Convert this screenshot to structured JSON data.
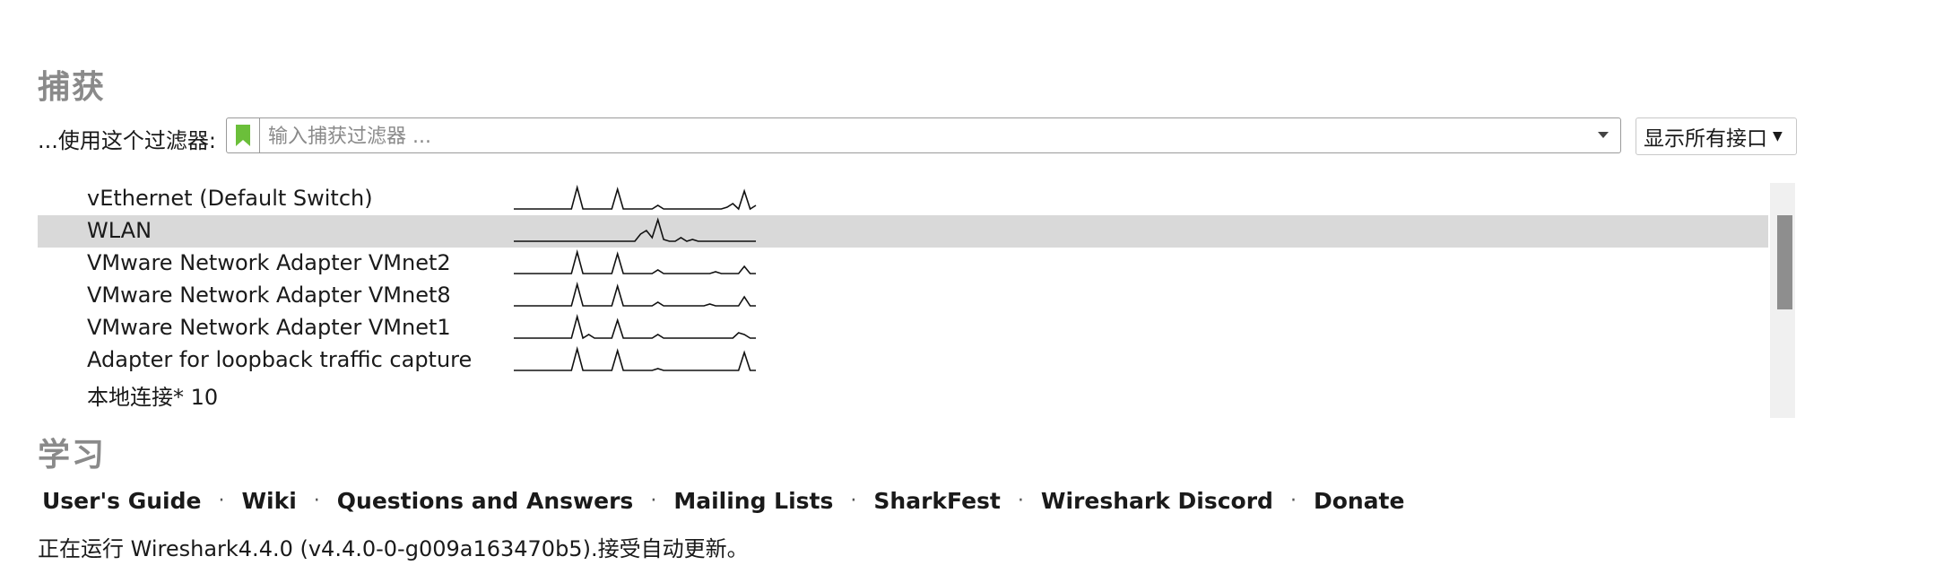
{
  "capture": {
    "heading": "捕获",
    "filter_label": "...使用这个过滤器:",
    "filter_placeholder": "输入捕获过滤器 ...",
    "filter_value": "",
    "interfaces_button": "显示所有接口",
    "bookmark_color": "#6bbf3a"
  },
  "interfaces": [
    {
      "name": "vEthernet (Default Switch)",
      "selected": false,
      "sparkline": [
        0,
        0,
        0,
        0,
        0,
        0,
        0,
        0,
        0,
        0,
        0,
        12,
        0,
        0,
        0,
        0,
        0,
        0,
        11,
        0,
        0,
        0,
        0,
        0,
        0,
        2,
        0,
        0,
        0,
        0,
        0,
        0,
        0,
        0,
        0,
        0,
        0,
        1,
        3,
        0,
        10,
        0,
        2
      ]
    },
    {
      "name": "WLAN",
      "selected": true,
      "sparkline": [
        0,
        0,
        0,
        0,
        0,
        0,
        0,
        0,
        0,
        0,
        0,
        0,
        0,
        0,
        0,
        0,
        0,
        0,
        0,
        0,
        0,
        0,
        4,
        6,
        2,
        12,
        1,
        0,
        0,
        2,
        0,
        1,
        0,
        0,
        0,
        0,
        0,
        0,
        0,
        0,
        0,
        0,
        0
      ]
    },
    {
      "name": "VMware Network Adapter VMnet2",
      "selected": false,
      "sparkline": [
        0,
        0,
        0,
        0,
        0,
        0,
        0,
        0,
        0,
        0,
        0,
        12,
        0,
        0,
        0,
        0,
        0,
        0,
        11,
        0,
        0,
        0,
        0,
        0,
        0,
        2,
        0,
        0,
        0,
        0,
        0,
        0,
        0,
        0,
        0,
        1,
        0,
        0,
        0,
        0,
        4,
        0,
        0
      ]
    },
    {
      "name": "VMware Network Adapter VMnet8",
      "selected": false,
      "sparkline": [
        0,
        0,
        0,
        0,
        0,
        0,
        0,
        0,
        0,
        0,
        0,
        12,
        0,
        0,
        0,
        0,
        0,
        0,
        11,
        0,
        0,
        0,
        0,
        0,
        0,
        2,
        0,
        0,
        0,
        0,
        0,
        0,
        0,
        0,
        1,
        0,
        0,
        0,
        0,
        0,
        5,
        0,
        0
      ]
    },
    {
      "name": "VMware Network Adapter VMnet1",
      "selected": false,
      "sparkline": [
        0,
        0,
        0,
        0,
        0,
        0,
        0,
        0,
        0,
        0,
        0,
        12,
        0,
        2,
        0,
        0,
        0,
        0,
        10,
        0,
        0,
        0,
        0,
        0,
        0,
        2,
        0,
        0,
        0,
        0,
        0,
        0,
        0,
        0,
        0,
        0,
        0,
        0,
        0,
        3,
        2,
        0,
        0
      ]
    },
    {
      "name": "Adapter for loopback traffic capture",
      "selected": false,
      "sparkline": [
        0,
        0,
        0,
        0,
        0,
        0,
        0,
        0,
        0,
        0,
        0,
        12,
        0,
        0,
        0,
        0,
        0,
        0,
        11,
        0,
        0,
        0,
        0,
        0,
        0,
        1,
        0,
        0,
        0,
        0,
        0,
        0,
        0,
        0,
        0,
        0,
        0,
        0,
        0,
        0,
        10,
        0,
        0
      ]
    },
    {
      "name": "本地连接* 10",
      "selected": false,
      "sparkline": []
    }
  ],
  "scrollbar": {
    "position": 0.19,
    "visible_fraction": 0.55
  },
  "learn": {
    "heading": "学习",
    "links": [
      "User's Guide",
      "Wiki",
      "Questions and Answers",
      "Mailing Lists",
      "SharkFest",
      "Wireshark Discord",
      "Donate"
    ],
    "separator": "·"
  },
  "status": {
    "text": "正在运行 Wireshark4.4.0 (v4.4.0-0-g009a163470b5).接受自动更新。"
  },
  "colors": {
    "heading": "#8a8a8a",
    "selected_row": "#d9d9d9",
    "text": "#1a1a1a"
  }
}
